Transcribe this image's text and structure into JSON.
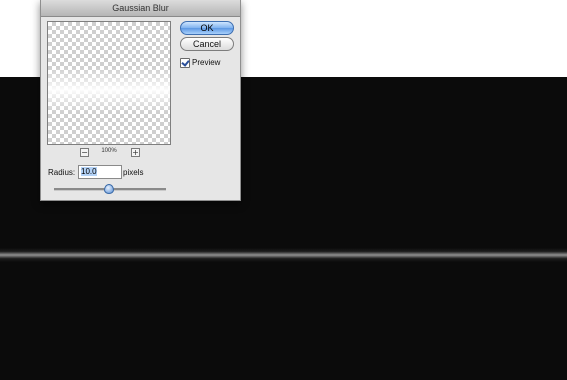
{
  "dialog": {
    "title": "Gaussian Blur",
    "ok_label": "OK",
    "cancel_label": "Cancel",
    "preview_label": "Preview",
    "preview_checked": true,
    "zoom": {
      "minus": "−",
      "plus": "+",
      "level": "100%"
    },
    "radius": {
      "label": "Radius:",
      "value": "10.0",
      "units": "pixels"
    },
    "slider_level": 0.48
  },
  "colors": {
    "canvas_background": "#0b0b0b",
    "glow": "#ffffff",
    "primary_button": "#5b97e3"
  }
}
